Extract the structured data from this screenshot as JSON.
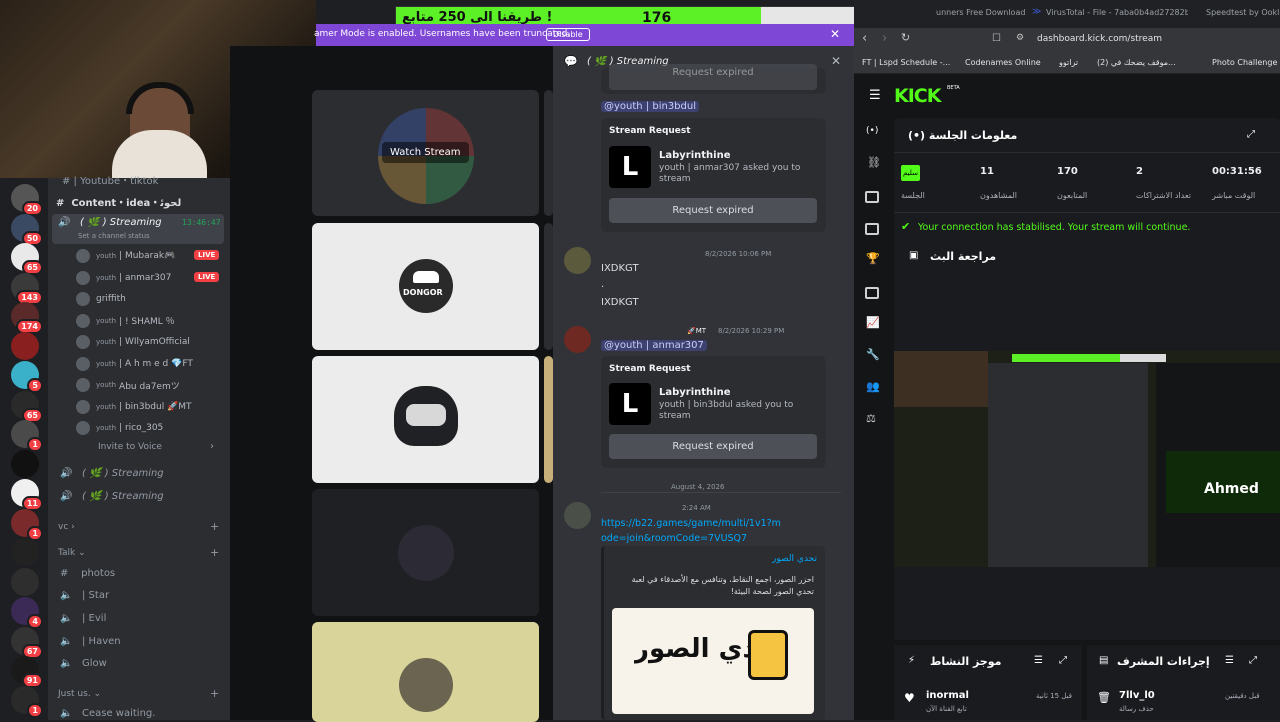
{
  "overlay": {
    "left_count": "250",
    "right_count": "176",
    "goal_text": "طريقنا الى 250 متابع !"
  },
  "streamer_banner": {
    "text": "amer Mode is enabled. Usernames have been truncated.",
    "button": "Disable"
  },
  "channels": {
    "partial_top": "Youtube・tiktok",
    "category_content": "Content・idea・ﻟﺤﻮﺋ",
    "active_voice": "( 🌿 ) Streaming",
    "active_time": "13:46:47",
    "set_status": "Set a channel status",
    "users": [
      {
        "tag": "youth",
        "name": "| Mubarak🎮",
        "live": "LIVE"
      },
      {
        "tag": "youth",
        "name": "| anmar307",
        "live": "LIVE"
      },
      {
        "tag": "",
        "name": "griffith",
        "live": ""
      },
      {
        "tag": "youth",
        "name": "| ! SHAML ％",
        "live": ""
      },
      {
        "tag": "youth",
        "name": "| WIlyamOfficial",
        "live": ""
      },
      {
        "tag": "youth",
        "name": "| A h m e d 💎FT",
        "live": ""
      },
      {
        "tag": "youth",
        "name": "Abu da7emツ",
        "live": ""
      },
      {
        "tag": "youth",
        "name": "| bin3bdul 🚀MT",
        "live": ""
      },
      {
        "tag": "youth",
        "name": "| rico_305",
        "live": ""
      }
    ],
    "invite": "Invite to Voice",
    "voice2": "( 🌿 ) Streaming",
    "voice3": "( 🌿 ) Streaming",
    "cat_vc": "vc",
    "cat_talk": "Talk",
    "talk_items": [
      "photos",
      "| Star",
      "| Evil",
      "| Haven",
      "Glow"
    ],
    "cat_just": "Just us.",
    "cease": "Cease waiting."
  },
  "rail_badges": [
    "20",
    "50",
    "65",
    "143",
    "174",
    "",
    "5",
    "65",
    "1",
    "",
    "11",
    "1",
    "",
    "",
    "4",
    "67",
    "91",
    "1"
  ],
  "grid": {
    "watch": "Watch Stream",
    "dongor": "DONGOR"
  },
  "chat": {
    "header": "( 🌿 ) Streaming",
    "partial_btn": "Request expired",
    "mention1": "@youth | bin3bdul",
    "req1_title": "Stream Request",
    "req1_game": "Labyrinthine",
    "req1_desc": "youth | anmar307 asked you to stream",
    "req1_btn": "Request expired",
    "msg_time": "8/2/2026 10:06 PM",
    "msg1": "IXDKGT",
    "msg_dot": ".",
    "msg2": "IXDKGT",
    "msg2_role": "🚀MT",
    "msg2_time": "8/2/2026 10:29 PM",
    "mention2": "@youth | anmar307",
    "req2_title": "Stream Request",
    "req2_game": "Labyrinthine",
    "req2_desc": "youth | bin3bdul asked you to stream",
    "req2_btn": "Request expired",
    "date_div": "August 4, 2026",
    "msg3_time": "2:24 AM",
    "link": "https://b22.games/game/multi/1v1?mode=join&roomCode=7VUSQ7",
    "embed_title": "تحدي الصور",
    "embed_desc": "احزر الصور، اجمع النقاط، وتنافس مع الأصدقاء في لعبة تحدي الصور لصحة البيئة!"
  },
  "browser": {
    "tabs": [
      "unners Free Download - Ani",
      "VirusTotal - File - 7aba0b4ad27282b",
      "Speedtest by Ookla"
    ],
    "url": "dashboard.kick.com/stream",
    "bookmarks": [
      "FT | Lspd Schedule -...",
      "Codenames Online",
      "تراتوو",
      "(2) موقف يضحك في...",
      "Photo Challenge -"
    ]
  },
  "kick": {
    "logo": "KICK",
    "beta": "BETA",
    "session_title": "معلومات الجلسة (•)",
    "stats": [
      {
        "value": "00:31:56",
        "label": "الوقت مباشر"
      },
      {
        "value": "2",
        "label": "تعداد الاشتراكات"
      },
      {
        "value": "170",
        "label": "المتابعون"
      },
      {
        "value": "11",
        "label": "المشاهدون"
      }
    ],
    "session_badge": "سليم",
    "session_label": "الجلسة",
    "status_msg": "Your connection has stabilised. Your stream will continue.",
    "review_title": "مراجعة البث",
    "activity_title": "موجز النشاط",
    "mod_title": "إجراءات المشرف",
    "activity_user": "inormal",
    "activity_desc": "تابع القناة الآن",
    "activity_time": "قبل 15 ثانية",
    "mod_user": "7llv_l0",
    "mod_desc": "حذف رسالة",
    "mod_time": "قبل دقيقتين",
    "preview_name": "Ahmed",
    "accent": "#53fc18"
  }
}
